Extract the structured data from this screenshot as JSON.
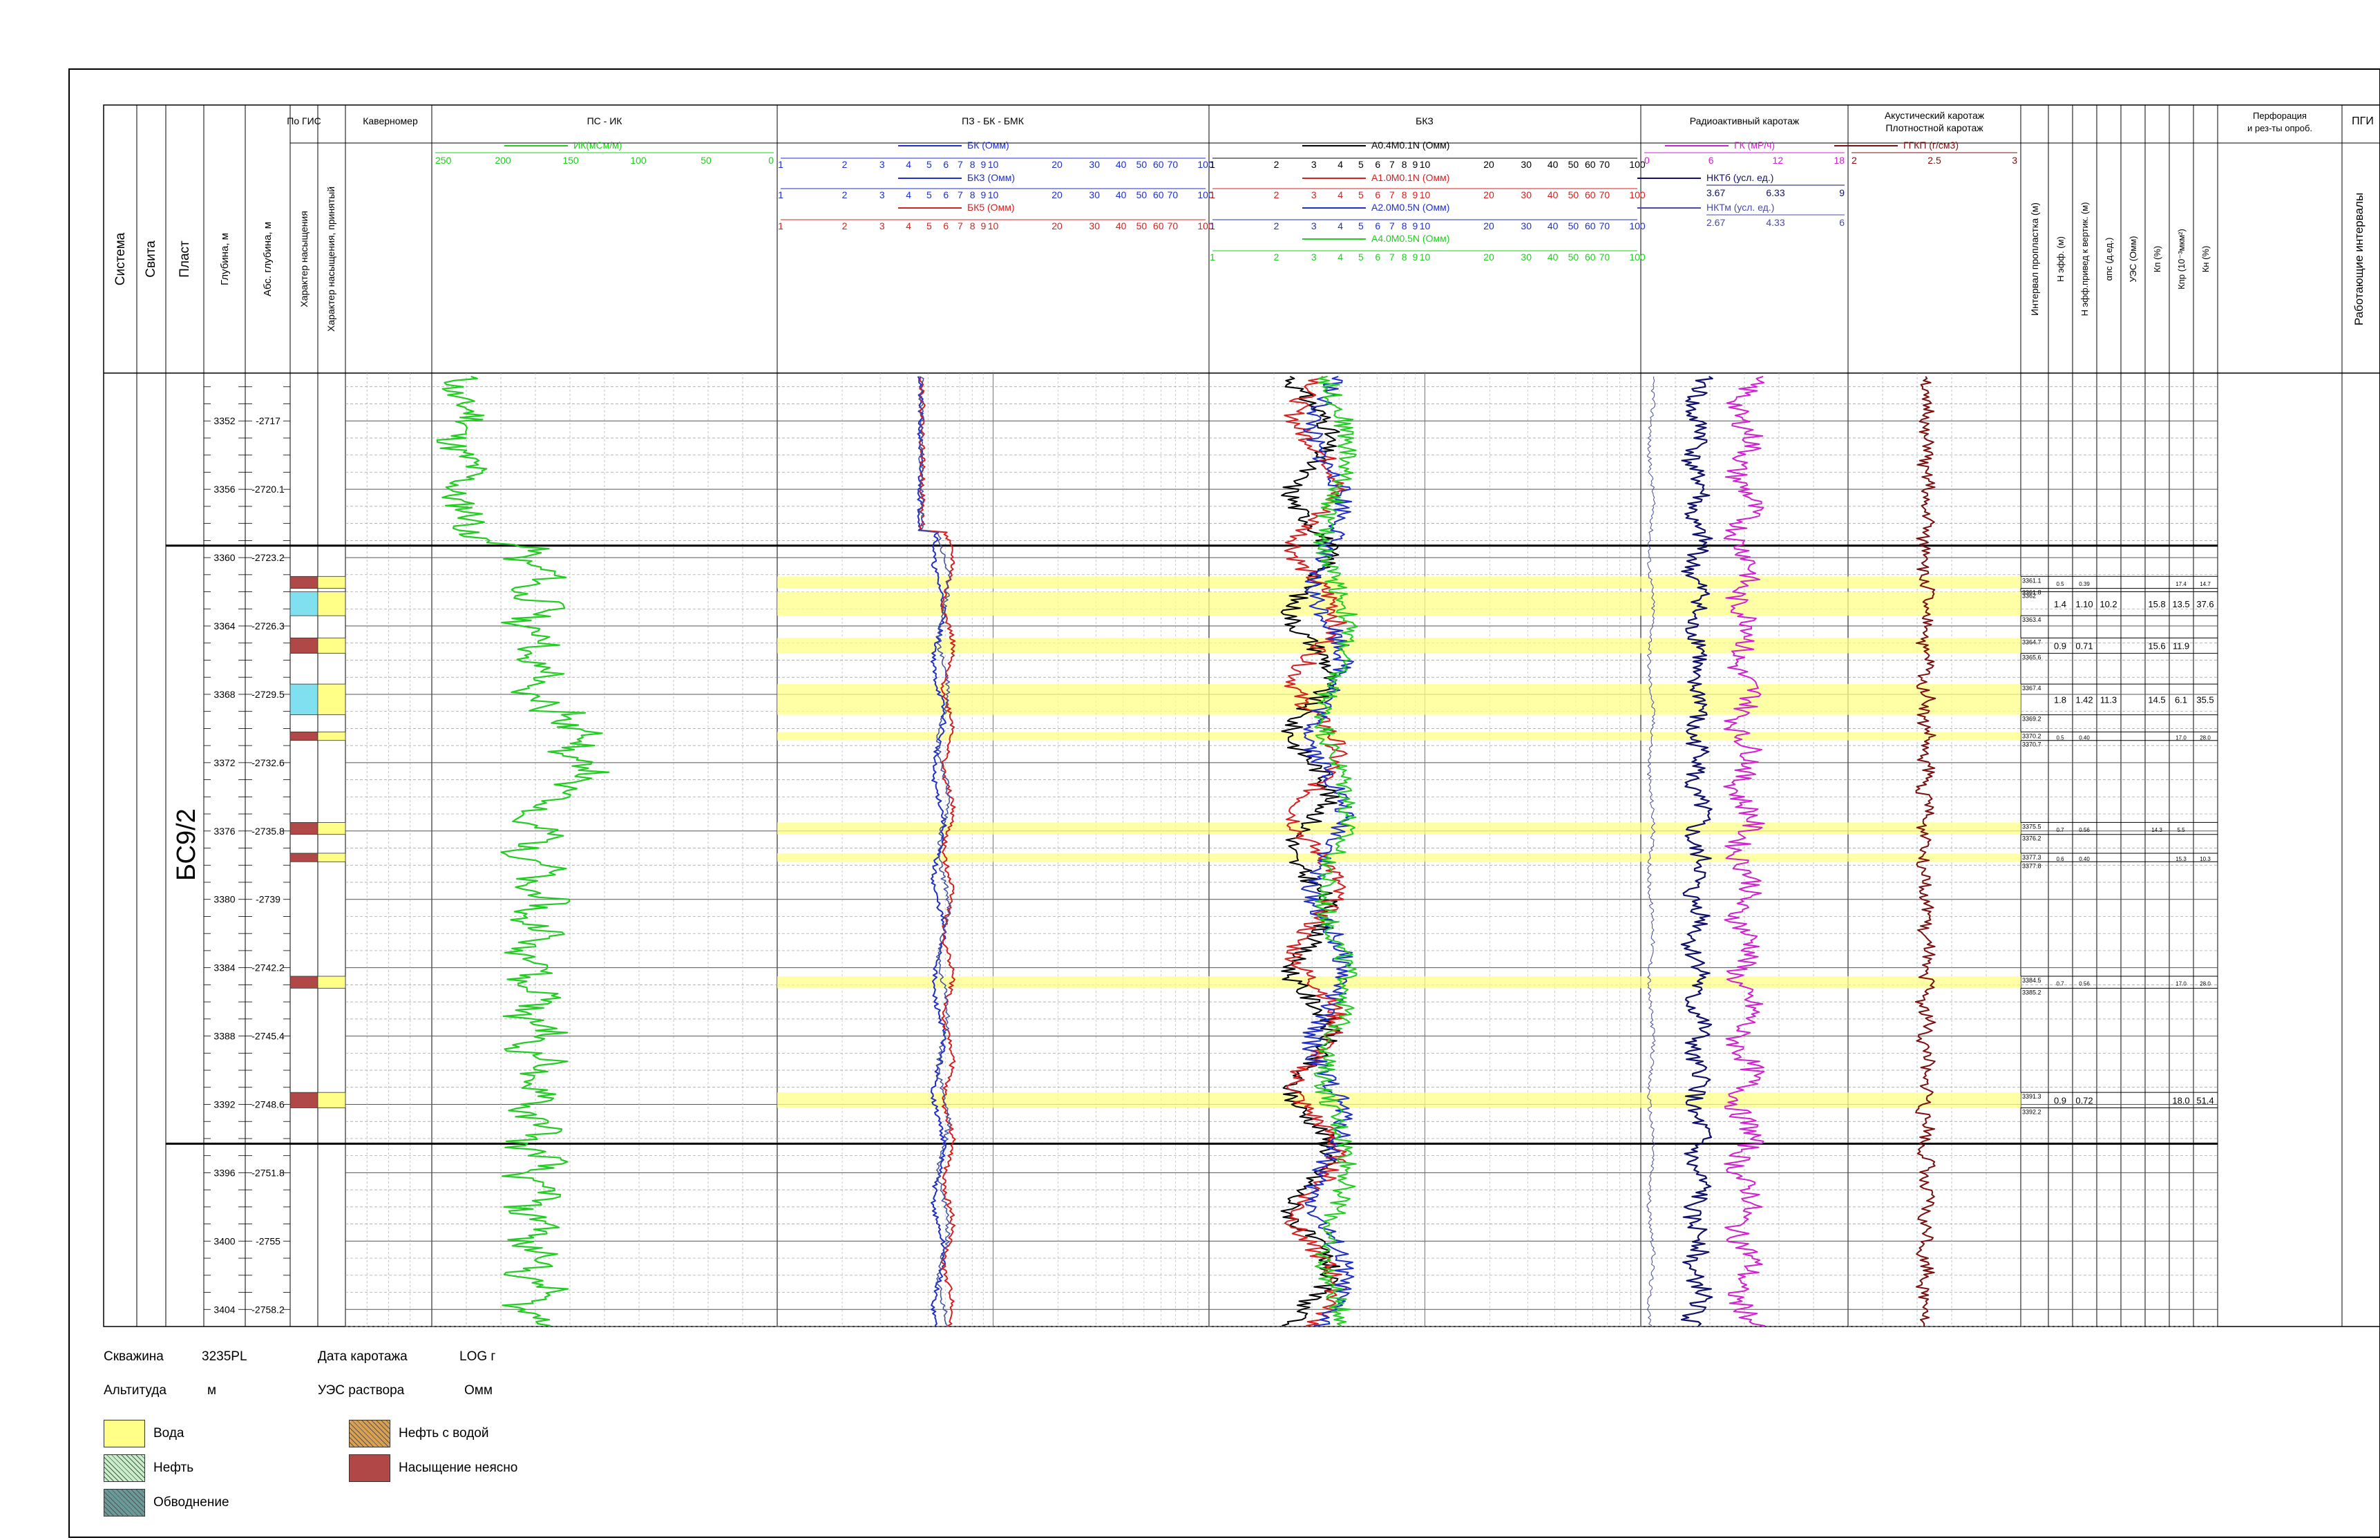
{
  "columns": {
    "sistema": "Система",
    "svita": "Свита",
    "plast": "Пласт",
    "depth": "Глубина, м",
    "abs_depth": "Абс. глубина, м",
    "po_gis": "По ГИС",
    "nasyshchenie": "Характер насыщения",
    "nasyshchenie_prin": "Характер насыщения, принятый",
    "kavernomer": "Каверномер",
    "ps_ik": "ПС - ИК",
    "pz_bk_bmk": "ПЗ - БК - БМК",
    "bkz": "БКЗ",
    "radio": "Радиоактивный каротаж",
    "akust": "Акустический каротаж",
    "plotn": "Плотностной каротаж",
    "interval": "Интервал пропластка (м)",
    "h_eff": "Н эфф. (м)",
    "h_eff_vert": "Н эфф.привед к вертик. (м)",
    "alpha_ps": "αпс (д.ед.)",
    "ues": "УЭС (Омм)",
    "kp": "Кп (%)",
    "kpr": "Кпр (10⁻³мкм²)",
    "kn": "Кн (%)",
    "perf": "Перфорация",
    "perf2": "и рез-ты опроб.",
    "pgi": "ПГИ",
    "rab_int": "Работающие интервалы"
  },
  "curve_headers": {
    "ik": {
      "label": "ИК(мСм/м)",
      "color": "#22cc22",
      "ticks": [
        "250",
        "200",
        "150",
        "100",
        "50",
        "0"
      ]
    },
    "bk": {
      "label": "БК (Омм)",
      "color": "#1f2fc8"
    },
    "bkz_short": {
      "label": "БКЗ (Омм)",
      "color": "#1f2fc8"
    },
    "bk5": {
      "label": "БК5 (Омм)",
      "color": "#d42020"
    },
    "a04": {
      "label": "А0.4М0.1N (Омм)",
      "color": "#000000"
    },
    "a10": {
      "label": "А1.0М0.1N (Омм)",
      "color": "#d42020"
    },
    "a20": {
      "label": "А2.0М0.5N (Омм)",
      "color": "#1f2fc8"
    },
    "a40": {
      "label": "А4.0М0.5N (Омм)",
      "color": "#22cc22"
    },
    "gk": {
      "label": "ГК (мР/ч)",
      "color": "#d020d0",
      "ticks": [
        "0",
        "6",
        "12",
        "18"
      ]
    },
    "nkt6": {
      "label": "НКТб (усл. ед.)",
      "color": "#10106a",
      "ticks": [
        "3.67",
        "6.33",
        "9"
      ]
    },
    "nktm": {
      "label": "НКТм (усл. ед.)",
      "color": "#4a4aa0",
      "ticks": [
        "2.67",
        "4.33",
        "6"
      ]
    },
    "ggkp": {
      "label": "ГГКП (г/см3)",
      "color": "#7a1010",
      "ticks": [
        "2",
        "2.5",
        "3"
      ]
    },
    "log_ticks": [
      "1",
      "2",
      "3",
      "4",
      "5",
      "6",
      "7",
      "8",
      "9",
      "10",
      "20",
      "30",
      "40",
      "50",
      "60",
      "70",
      "100"
    ]
  },
  "depth_labels": [
    {
      "md": "3352",
      "abs": "-2717"
    },
    {
      "md": "3356",
      "abs": "-2720.1"
    },
    {
      "md": "3360",
      "abs": "-2723.2"
    },
    {
      "md": "3364",
      "abs": "-2726.3"
    },
    {
      "md": "3368",
      "abs": "-2729.5"
    },
    {
      "md": "3372",
      "abs": "-2732.6"
    },
    {
      "md": "3376",
      "abs": "-2735.8"
    },
    {
      "md": "3380",
      "abs": "-2739"
    },
    {
      "md": "3384",
      "abs": "-2742.2"
    },
    {
      "md": "3388",
      "abs": "-2745.4"
    },
    {
      "md": "3392",
      "abs": "-2748.6"
    },
    {
      "md": "3396",
      "abs": "-2751.8"
    },
    {
      "md": "3400",
      "abs": "-2755"
    },
    {
      "md": "3404",
      "abs": "-2758.2"
    }
  ],
  "formation": {
    "name": "БС9/2",
    "top_md": 3359.3,
    "bottom_md": 3394.3
  },
  "layers": [
    {
      "top": 3361.1,
      "bot": 3361.8,
      "sat": "Насыщение неясно",
      "interval_top": "3361.1",
      "interval_bot": "3361.8",
      "h_eff": "0.5",
      "h_vert": "0.39",
      "alpha": "",
      "ues": "",
      "kp": "17.4",
      "kpr": "14.7",
      "kn": ""
    },
    {
      "top": 3362.0,
      "bot": 3363.4,
      "sat": "Вода",
      "interval_top": "3362",
      "interval_bot": "3363.4",
      "h_eff": "1.4",
      "h_vert": "1.10",
      "alpha": "10.2",
      "ues": "15.8",
      "kp": "13.5",
      "kpr": "37.6",
      "kn": ""
    },
    {
      "top": 3364.7,
      "bot": 3365.6,
      "sat": "Насыщение неясно",
      "interval_top": "3364.7",
      "interval_bot": "3365.6",
      "h_eff": "0.9",
      "h_vert": "0.71",
      "alpha": "",
      "ues": "15.6",
      "kp": "11.9",
      "kpr": "",
      "kn": ""
    },
    {
      "top": 3367.4,
      "bot": 3369.2,
      "sat": "Вода",
      "interval_top": "3367.4",
      "interval_bot": "3369.2",
      "h_eff": "1.8",
      "h_vert": "1.42",
      "alpha": "11.3",
      "ues": "14.5",
      "kp": "6.1",
      "kpr": "35.5",
      "kn": ""
    },
    {
      "top": 3370.2,
      "bot": 3370.7,
      "sat": "Насыщение неясно",
      "interval_top": "3370.2",
      "interval_bot": "3370.7",
      "h_eff": "0.5",
      "h_vert": "0.40",
      "alpha": "",
      "ues": "",
      "kp": "17.0",
      "kpr": "28.0",
      "kn": ""
    },
    {
      "top": 3375.5,
      "bot": 3376.2,
      "sat": "Насыщение неясно",
      "interval_top": "3375.5",
      "interval_bot": "3376.2",
      "h_eff": "0.7",
      "h_vert": "0.56",
      "alpha": "",
      "ues": "14.3",
      "kp": "5.5",
      "kpr": "",
      "kn": ""
    },
    {
      "top": 3377.3,
      "bot": 3377.8,
      "sat": "Насыщение неясно",
      "interval_top": "3377.3",
      "interval_bot": "3377.8",
      "h_eff": "0.6",
      "h_vert": "0.40",
      "alpha": "",
      "ues": "",
      "kp": "15.3",
      "kpr": "10.3",
      "kn": ""
    },
    {
      "top": 3384.5,
      "bot": 3385.2,
      "sat": "Насыщение неясно",
      "interval_top": "3384.5",
      "interval_bot": "3385.2",
      "h_eff": "0.7",
      "h_vert": "0.56",
      "alpha": "",
      "ues": "",
      "kp": "17.0",
      "kpr": "28.0",
      "kn": ""
    },
    {
      "top": 3391.3,
      "bot": 3392.2,
      "sat": "Насыщение неясно",
      "interval_top": "3391.3",
      "interval_bot": "3392.2",
      "h_eff": "0.9",
      "h_vert": "0.72",
      "alpha": "",
      "ues": "",
      "kp": "18.0",
      "kpr": "51.4",
      "kn": ""
    }
  ],
  "footer": {
    "well_label": "Скважина",
    "well_value": "3235PL",
    "date_label": "Дата каротажа",
    "date_value": "LOG г",
    "alt_label": "Альтитуда",
    "alt_value": "м",
    "ues_label": "УЭС раствора",
    "ues_value": "Омм"
  },
  "legend": [
    {
      "label": "Вода",
      "color": "#ffff88",
      "pattern": "solid"
    },
    {
      "label": "Нефть с водой",
      "color": "#d8a050",
      "pattern": "hatch"
    },
    {
      "label": "Нефть",
      "color": "#c8f0c8",
      "pattern": "hatch-green"
    },
    {
      "label": "Насыщение неясно",
      "color": "#b04848",
      "pattern": "solid"
    },
    {
      "label": "Обводнение",
      "color": "#6a9a9a",
      "pattern": "hatch-teal"
    }
  ],
  "colors": {
    "water": "#ffff88",
    "unclear": "#b04848",
    "cyan": "#80e0f0"
  }
}
